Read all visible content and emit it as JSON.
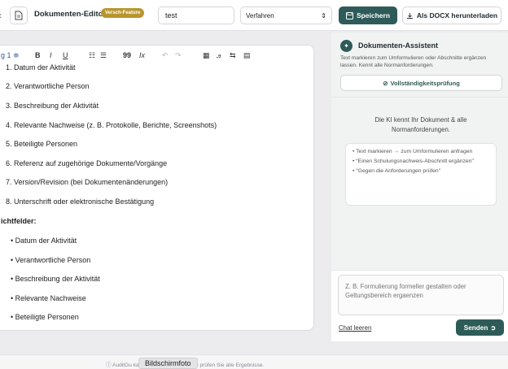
{
  "topbar": {
    "back_label": "‹",
    "app_title": "Dokumenten-Editor",
    "badge": "Versch-Feature",
    "title_value": "test",
    "procedure_value": "Verfahren",
    "save_label": "Speichern",
    "docx_label": "Als DOCX herunterladen"
  },
  "toolbar": {
    "heading": "g 1 ≑",
    "bold": "B",
    "italic": "I",
    "underline": "U",
    "ordered_list": "☷",
    "bullet_list": "☰",
    "quote": "99",
    "clear_format": "Ix",
    "undo": "↶",
    "redo": "↷",
    "table": "▦",
    "extra1": "ꭿ",
    "extra2": "⇆",
    "extra3": "▤"
  },
  "editor": {
    "numbered": [
      "1. Datum der Aktivität",
      "2. Verantwortliche Person",
      "3. Beschreibung der Aktivität",
      "4. Relevante Nachweise (z. B. Protokolle, Berichte, Screenshots)",
      "5. Beteiligte Personen",
      "6. Referenz auf zugehörige Dokumente/Vorgänge",
      "7. Version/Revision (bei Dokumentenänderungen)",
      "8. Unterschrift oder elektronische Bestätigung"
    ],
    "section_heading": "ichtfelder:",
    "bullets": [
      "• Datum der Aktivität",
      "• Verantwortliche Person",
      "• Beschreibung der Aktivität",
      "• Relevante Nachweise",
      "• Beteiligte Personen"
    ]
  },
  "assistant": {
    "title": "Dokumenten-Assistent",
    "description": "Text markieren zum Umformulieren oder Abschnitte ergänzen lassen. Kennt alle Normanforderungen.",
    "check_label": "Vollständigkeitsprüfung",
    "intro": "Die KI kennt Ihr Dokument & alle Normanforderungen.",
    "hints": [
      "• Text markieren → zum Umformulieren anfragen",
      "• \"Einen Schulungsnachweis-Abschnitt ergänzen\"",
      "• \"Gegen die Anforderungen prüfen\""
    ],
    "input_placeholder": "Z. B. Formulierung formeller gestalten oder Geltungsbereich ergaenzen",
    "clear_label": "Chat leeren",
    "send_label": "Senden"
  },
  "footer": {
    "text": "ⓘ AuditGu                                       kann Fehler machen – bitte prüfen Sie alle Ergebnisse.",
    "tooltip": "Bildschirmfoto"
  },
  "colors": {
    "accent": "#2e5b58",
    "badge": "#b8962e"
  }
}
